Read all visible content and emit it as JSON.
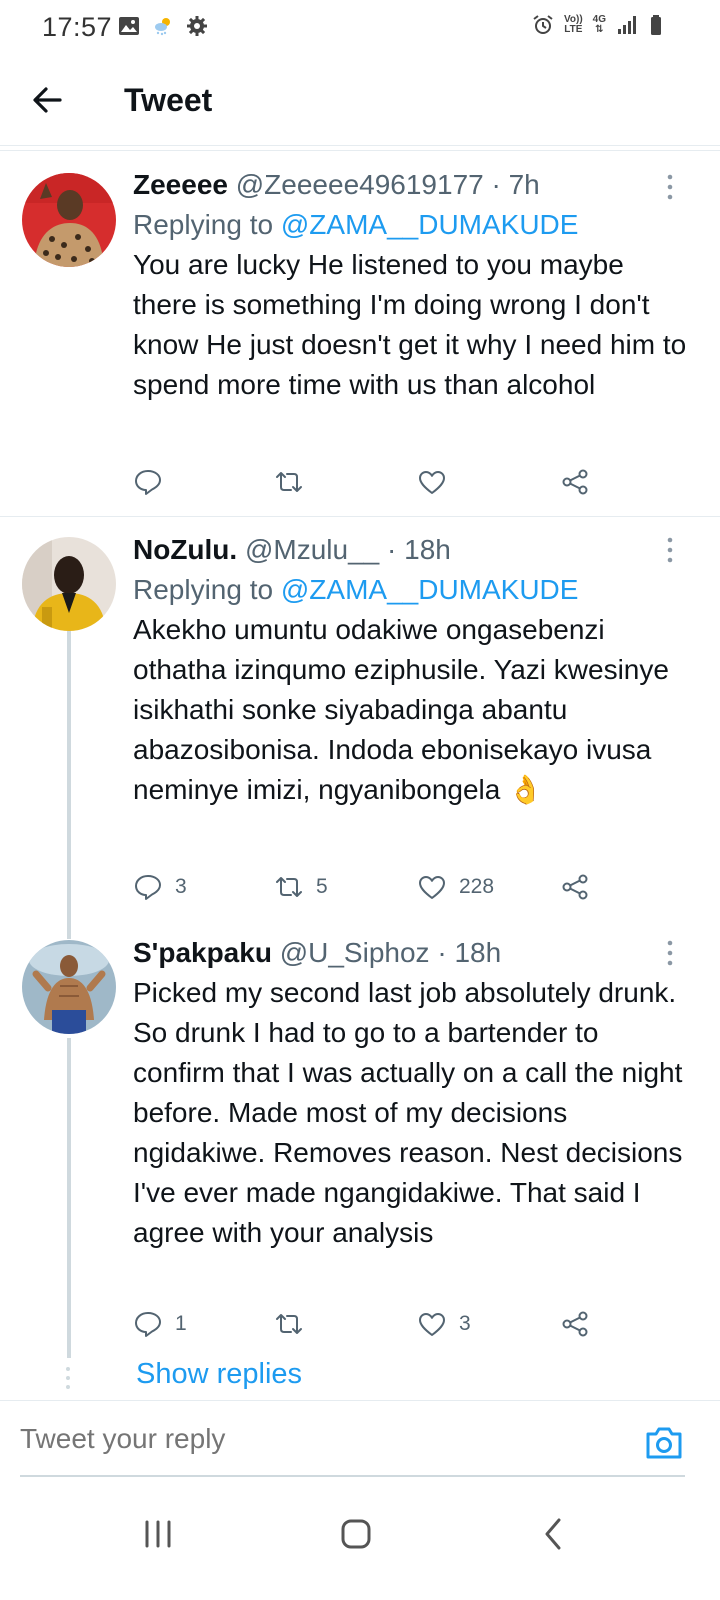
{
  "status_bar": {
    "time": "17:57",
    "left_icons": [
      "image-icon",
      "weather-icon",
      "settings-icon"
    ],
    "right_icons": [
      "alarm-icon",
      "volte-icon",
      "4g-icon",
      "signal-icon",
      "battery-icon"
    ],
    "volte_line1": "Vo))",
    "volte_line2": "LTE",
    "net_label": "4G"
  },
  "header": {
    "title": "Tweet"
  },
  "tweets": [
    {
      "name": "Zeeeee",
      "handle": "@Zeeeee49619177",
      "time": "7h",
      "replying_label": "Replying to",
      "replying_to": "@ZAMA__DUMAKUDE",
      "text": "You are lucky He listened to you maybe there is something I'm doing wrong I don't know He just doesn't get it why I need him to spend more time with us than alcohol",
      "replies": "",
      "retweets": "",
      "likes": ""
    },
    {
      "name": "NoZulu.",
      "handle": "@Mzulu__",
      "time": "18h",
      "replying_label": "Replying to",
      "replying_to": "@ZAMA__DUMAKUDE",
      "text": "Akekho umuntu odakiwe ongasebenzi othatha izinqumo eziphusile. Yazi kwesinye isikhathi sonke siyabadinga abantu abazosibonisa. Indoda ebonisekayo ivusa neminye imizi, ngyanibongela 👌",
      "replies": "3",
      "retweets": "5",
      "likes": "228"
    },
    {
      "name": "S'pakpaku",
      "handle": "@U_Siphoz",
      "time": "18h",
      "text": "Picked my second last job absolutely drunk. So drunk I had to go to a bartender to confirm that I was actually on a call the night before. Made most of my decisions ngidakiwe. Removes reason. Nest decisions I've ever made ngangidakiwe. That said I agree with your analysis",
      "replies": "1",
      "retweets": "",
      "likes": "3"
    }
  ],
  "show_replies": "Show replies",
  "composer": {
    "placeholder": "Tweet your reply"
  },
  "nav": [
    "recent-apps",
    "home",
    "back"
  ],
  "colors": {
    "accent": "#1d9bf0",
    "text": "#0f1419",
    "muted": "#536471"
  }
}
